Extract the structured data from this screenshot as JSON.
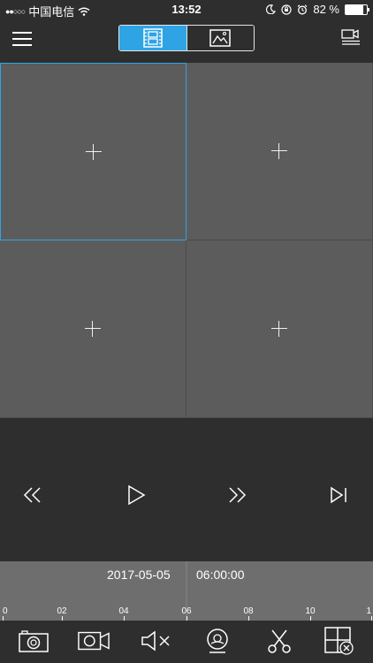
{
  "status_bar": {
    "signal": "●●○○○",
    "carrier": "中国电信",
    "time": "13:52",
    "battery_text": "82 %",
    "battery_level": 0.82
  },
  "header": {
    "active_mode": "video-playback",
    "modes": [
      "video-playback-icon",
      "picture-icon"
    ]
  },
  "grid": {
    "selected_cell": 0,
    "cells": 4
  },
  "controls": [
    "rewind-icon",
    "play-icon",
    "fast-forward-icon",
    "next-frame-icon"
  ],
  "timeline": {
    "date": "2017-05-05",
    "time": "06:00:00",
    "ticks": [
      "0",
      "02",
      "04",
      "06",
      "08",
      "10",
      "1"
    ]
  },
  "toolbar": [
    "snapshot-icon",
    "record-icon",
    "mute-icon",
    "fisheye-icon",
    "clip-icon",
    "close-all-windows-icon"
  ],
  "colors": {
    "accent": "#2ea4e5",
    "background": "#2e2e2e",
    "cell": "#5c5c5c",
    "timeline": "#6e6e6e"
  }
}
